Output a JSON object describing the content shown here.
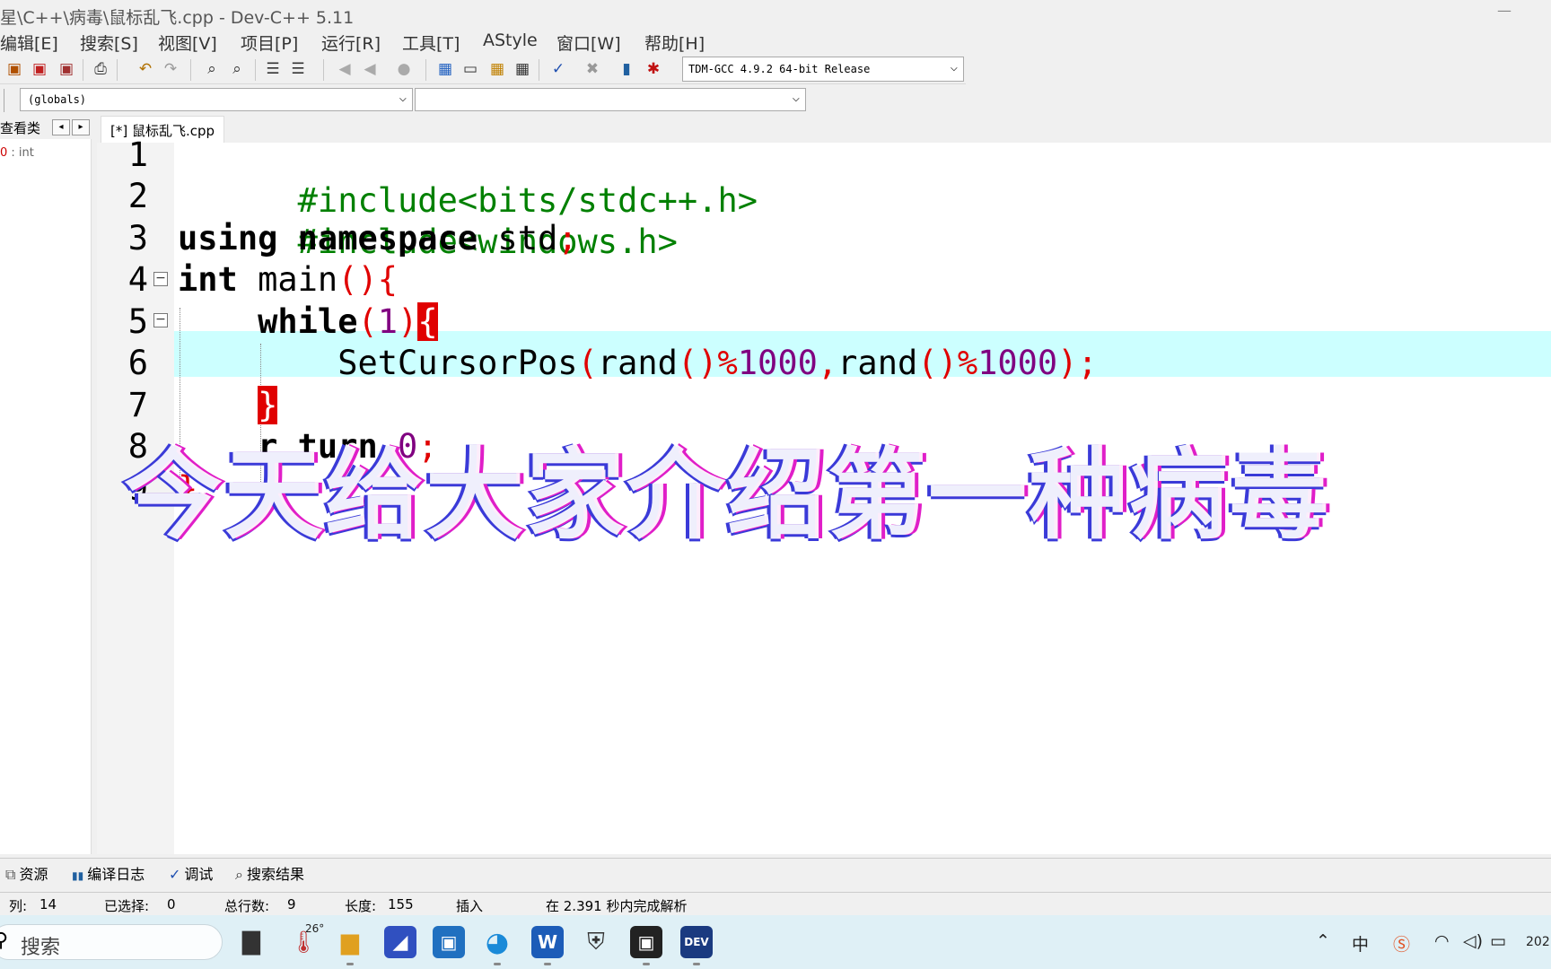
{
  "window": {
    "title": "星\\C++\\病毒\\鼠标乱飞.cpp - Dev-C++ 5.11",
    "minimize_glyph": "—"
  },
  "menu": [
    "编辑[E]",
    "搜索[S]",
    "视图[V]",
    "项目[P]",
    "运行[R]",
    "工具[T]",
    "AStyle",
    "窗口[W]",
    "帮助[H]"
  ],
  "toolbar": {
    "compiler": "TDM-GCC 4.9.2 64-bit Release",
    "dropdown_arrow": "⌵"
  },
  "scope": {
    "class_combo": "(globals)",
    "member_combo": ""
  },
  "left_panel": {
    "tab_label": "查看类",
    "prev": "◂",
    "next": "▸",
    "tree_item_prefix": "0",
    "tree_item": " : int"
  },
  "editor": {
    "tab": "[*] 鼠标乱飞.cpp",
    "line_numbers": [
      "1",
      "2",
      "3",
      "4",
      "5",
      "6",
      "7",
      "8",
      "9"
    ],
    "fold_glyph": "−",
    "l1": "#include<bits/stdc++.h>",
    "l2": "#include<windows.h>",
    "l3_kw": "using namespace",
    "l3_id": " std",
    "semicolon": ";",
    "l4_kw": "int",
    "l4_id": " main",
    "paren_pair": "()",
    "lbrace": "{",
    "l5_kw": "while",
    "paren_open": "(",
    "one": "1",
    "paren_close": ")",
    "l6_a": "SetCursorPos",
    "l6_b": "rand",
    "pct": "%",
    "thousand": "1000",
    "comma": ",",
    "close_paren_semi": ");",
    "rbrace": "}",
    "l8_tail": "r turn",
    "l8_zero": "0",
    "l8_semi": ";"
  },
  "overlay_caption": "今天给大家介绍第一种病毒",
  "bottom_tabs": [
    {
      "icon": "resources-icon",
      "glyph": "⧉",
      "label": "资源"
    },
    {
      "icon": "compile-log-icon",
      "glyph": "▮▮",
      "label": "编译日志"
    },
    {
      "icon": "debug-icon",
      "glyph": "✓",
      "label": "调试"
    },
    {
      "icon": "search-results-icon",
      "glyph": "⌕",
      "label": "搜索结果"
    }
  ],
  "status": {
    "col_label": "列:",
    "col_value": "14",
    "sel_label": "已选择:",
    "sel_value": "0",
    "lines_label": "总行数:",
    "lines_value": "9",
    "len_label": "长度:",
    "len_value": "155",
    "mode": "插入",
    "parse": "在 2.391 秒内完成解析"
  },
  "taskbar": {
    "search_placeholder": "搜索",
    "weather": "26°",
    "tray_ime": "中",
    "clock_partial": "202"
  },
  "colors": {
    "preprocessor": "#008000",
    "symbol": "#e00000",
    "number": "#800080",
    "current_line": "#ccffff"
  }
}
